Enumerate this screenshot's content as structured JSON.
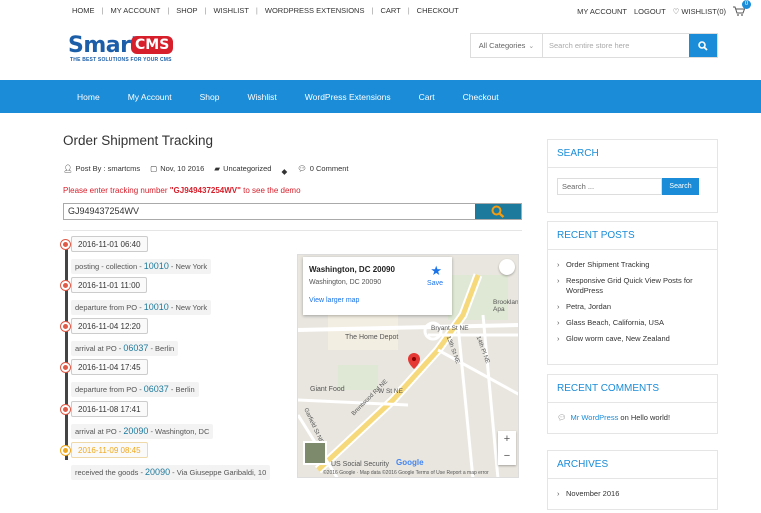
{
  "topbar": {
    "links": [
      "HOME",
      "MY ACCOUNT",
      "SHOP",
      "WISHLIST",
      "WORDPRESS EXTENSIONS",
      "CART",
      "CHECKOUT"
    ],
    "right": {
      "account": "MY ACCOUNT",
      "logout": "LOGOUT",
      "wishlist": "WISHLIST(0)",
      "cart_count": "0"
    }
  },
  "logo": {
    "smart": "Smart",
    "cms": "CMS",
    "tagline": "THE BEST SOLUTIONS FOR YOUR CMS"
  },
  "search": {
    "category": "All Categories",
    "placeholder": "Search entire store here"
  },
  "nav": [
    "Home",
    "My Account",
    "Shop",
    "Wishlist",
    "WordPress Extensions",
    "Cart",
    "Checkout"
  ],
  "post": {
    "title": "Order Shipment Tracking",
    "author": "Post By : smartcms",
    "date": "Nov, 10 2016",
    "category": "Uncategorized",
    "comments": "0 Comment",
    "notice_prefix": "Please enter tracking number ",
    "notice_code": "\"GJ949437254WV\"",
    "notice_suffix": " to see the demo",
    "tracking_value": "GJ949437254WV"
  },
  "timeline": [
    {
      "time": "2016-11-01 06:40",
      "text": "posting - collection - ",
      "code": "10010",
      "place": " - New York",
      "current": false
    },
    {
      "time": "2016-11-01 11:00",
      "text": "departure from PO - ",
      "code": "10010",
      "place": " - New York",
      "current": false
    },
    {
      "time": "2016-11-04 12:20",
      "text": "arrival at PO - ",
      "code": "06037",
      "place": " - Berlin",
      "current": false
    },
    {
      "time": "2016-11-04 17:45",
      "text": "departure from PO - ",
      "code": "06037",
      "place": " - Berlin",
      "current": false
    },
    {
      "time": "2016-11-08 17:41",
      "text": "arrival at PO - ",
      "code": "20090",
      "place": " - Washington, DC",
      "current": false
    },
    {
      "time": "2016-11-09 08:45",
      "text": "received the goods - ",
      "code": "20090",
      "place": " - Via Giuseppe Garibaldi, 10",
      "current": true
    }
  ],
  "map": {
    "popup_title": "Washington, DC 20090",
    "popup_sub": "Washington, DC 20090",
    "larger": "View larger map",
    "save": "Save",
    "labels": {
      "bryant": "Bryant St NE",
      "homedepot": "The Home Depot",
      "giant": "Giant Food",
      "w": "W St NE",
      "brentwood": "Brentwood Rd NE",
      "brookland": "Brookland Apa",
      "t13": "13th St NE",
      "t14": "14th Pl NE",
      "garfield": "Garfield St NE",
      "ussec": "US Social Security",
      "google": "Google"
    },
    "footer": "©2016 Google · Map data ©2016 Google   Terms of Use   Report a map error"
  },
  "sidebar": {
    "search_title": "SEARCH",
    "search_placeholder": "Search ...",
    "search_button": "Search",
    "recent_posts_title": "RECENT POSTS",
    "recent_posts": [
      "Order Shipment Tracking",
      "Responsive Grid Quick View Posts for WordPress",
      "Petra, Jordan",
      "Glass Beach, California, USA",
      "Glow worm cave, New Zealand"
    ],
    "recent_comments_title": "RECENT COMMENTS",
    "comment_author": "Mr WordPress",
    "comment_on": " on ",
    "comment_post": "Hello world!",
    "archives_title": "ARCHIVES",
    "archives": [
      "November 2016"
    ]
  }
}
